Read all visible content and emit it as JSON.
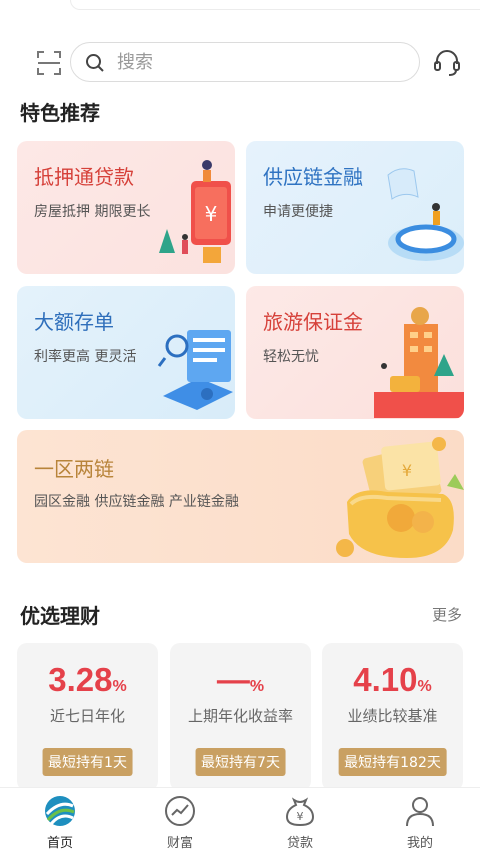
{
  "search": {
    "placeholder": "搜索"
  },
  "featured": {
    "title": "特色推荐",
    "cards": [
      {
        "title": "抵押通贷款",
        "subtitle": "房屋抵押 期限更长"
      },
      {
        "title": "供应链金融",
        "subtitle": "申请更便捷"
      },
      {
        "title": "大额存单",
        "subtitle": "利率更高 更灵活"
      },
      {
        "title": "旅游保证金",
        "subtitle": "轻松无忧"
      },
      {
        "title": "一区两链",
        "subtitle": "园区金融 供应链金融 产业链金融"
      }
    ]
  },
  "wealth": {
    "title": "优选理财",
    "more": "更多",
    "products": [
      {
        "rate": "3.28",
        "unit": "%",
        "label": "近七日年化",
        "badge": "最短持有1天"
      },
      {
        "rate": "—",
        "unit": "%",
        "label": "上期年化收益率",
        "badge": "最短持有7天"
      },
      {
        "rate": "4.10",
        "unit": "%",
        "label": "业绩比较基准",
        "badge": "最短持有182天"
      }
    ]
  },
  "tabs": [
    {
      "label": "首页",
      "icon": "home-logo-icon"
    },
    {
      "label": "财富",
      "icon": "trend-icon"
    },
    {
      "label": "贷款",
      "icon": "money-bag-icon"
    },
    {
      "label": "我的",
      "icon": "user-icon"
    }
  ],
  "colors": {
    "accent_red": "#e5414a",
    "gold_badge": "#c9a062",
    "blue_title": "#2f73c2"
  }
}
